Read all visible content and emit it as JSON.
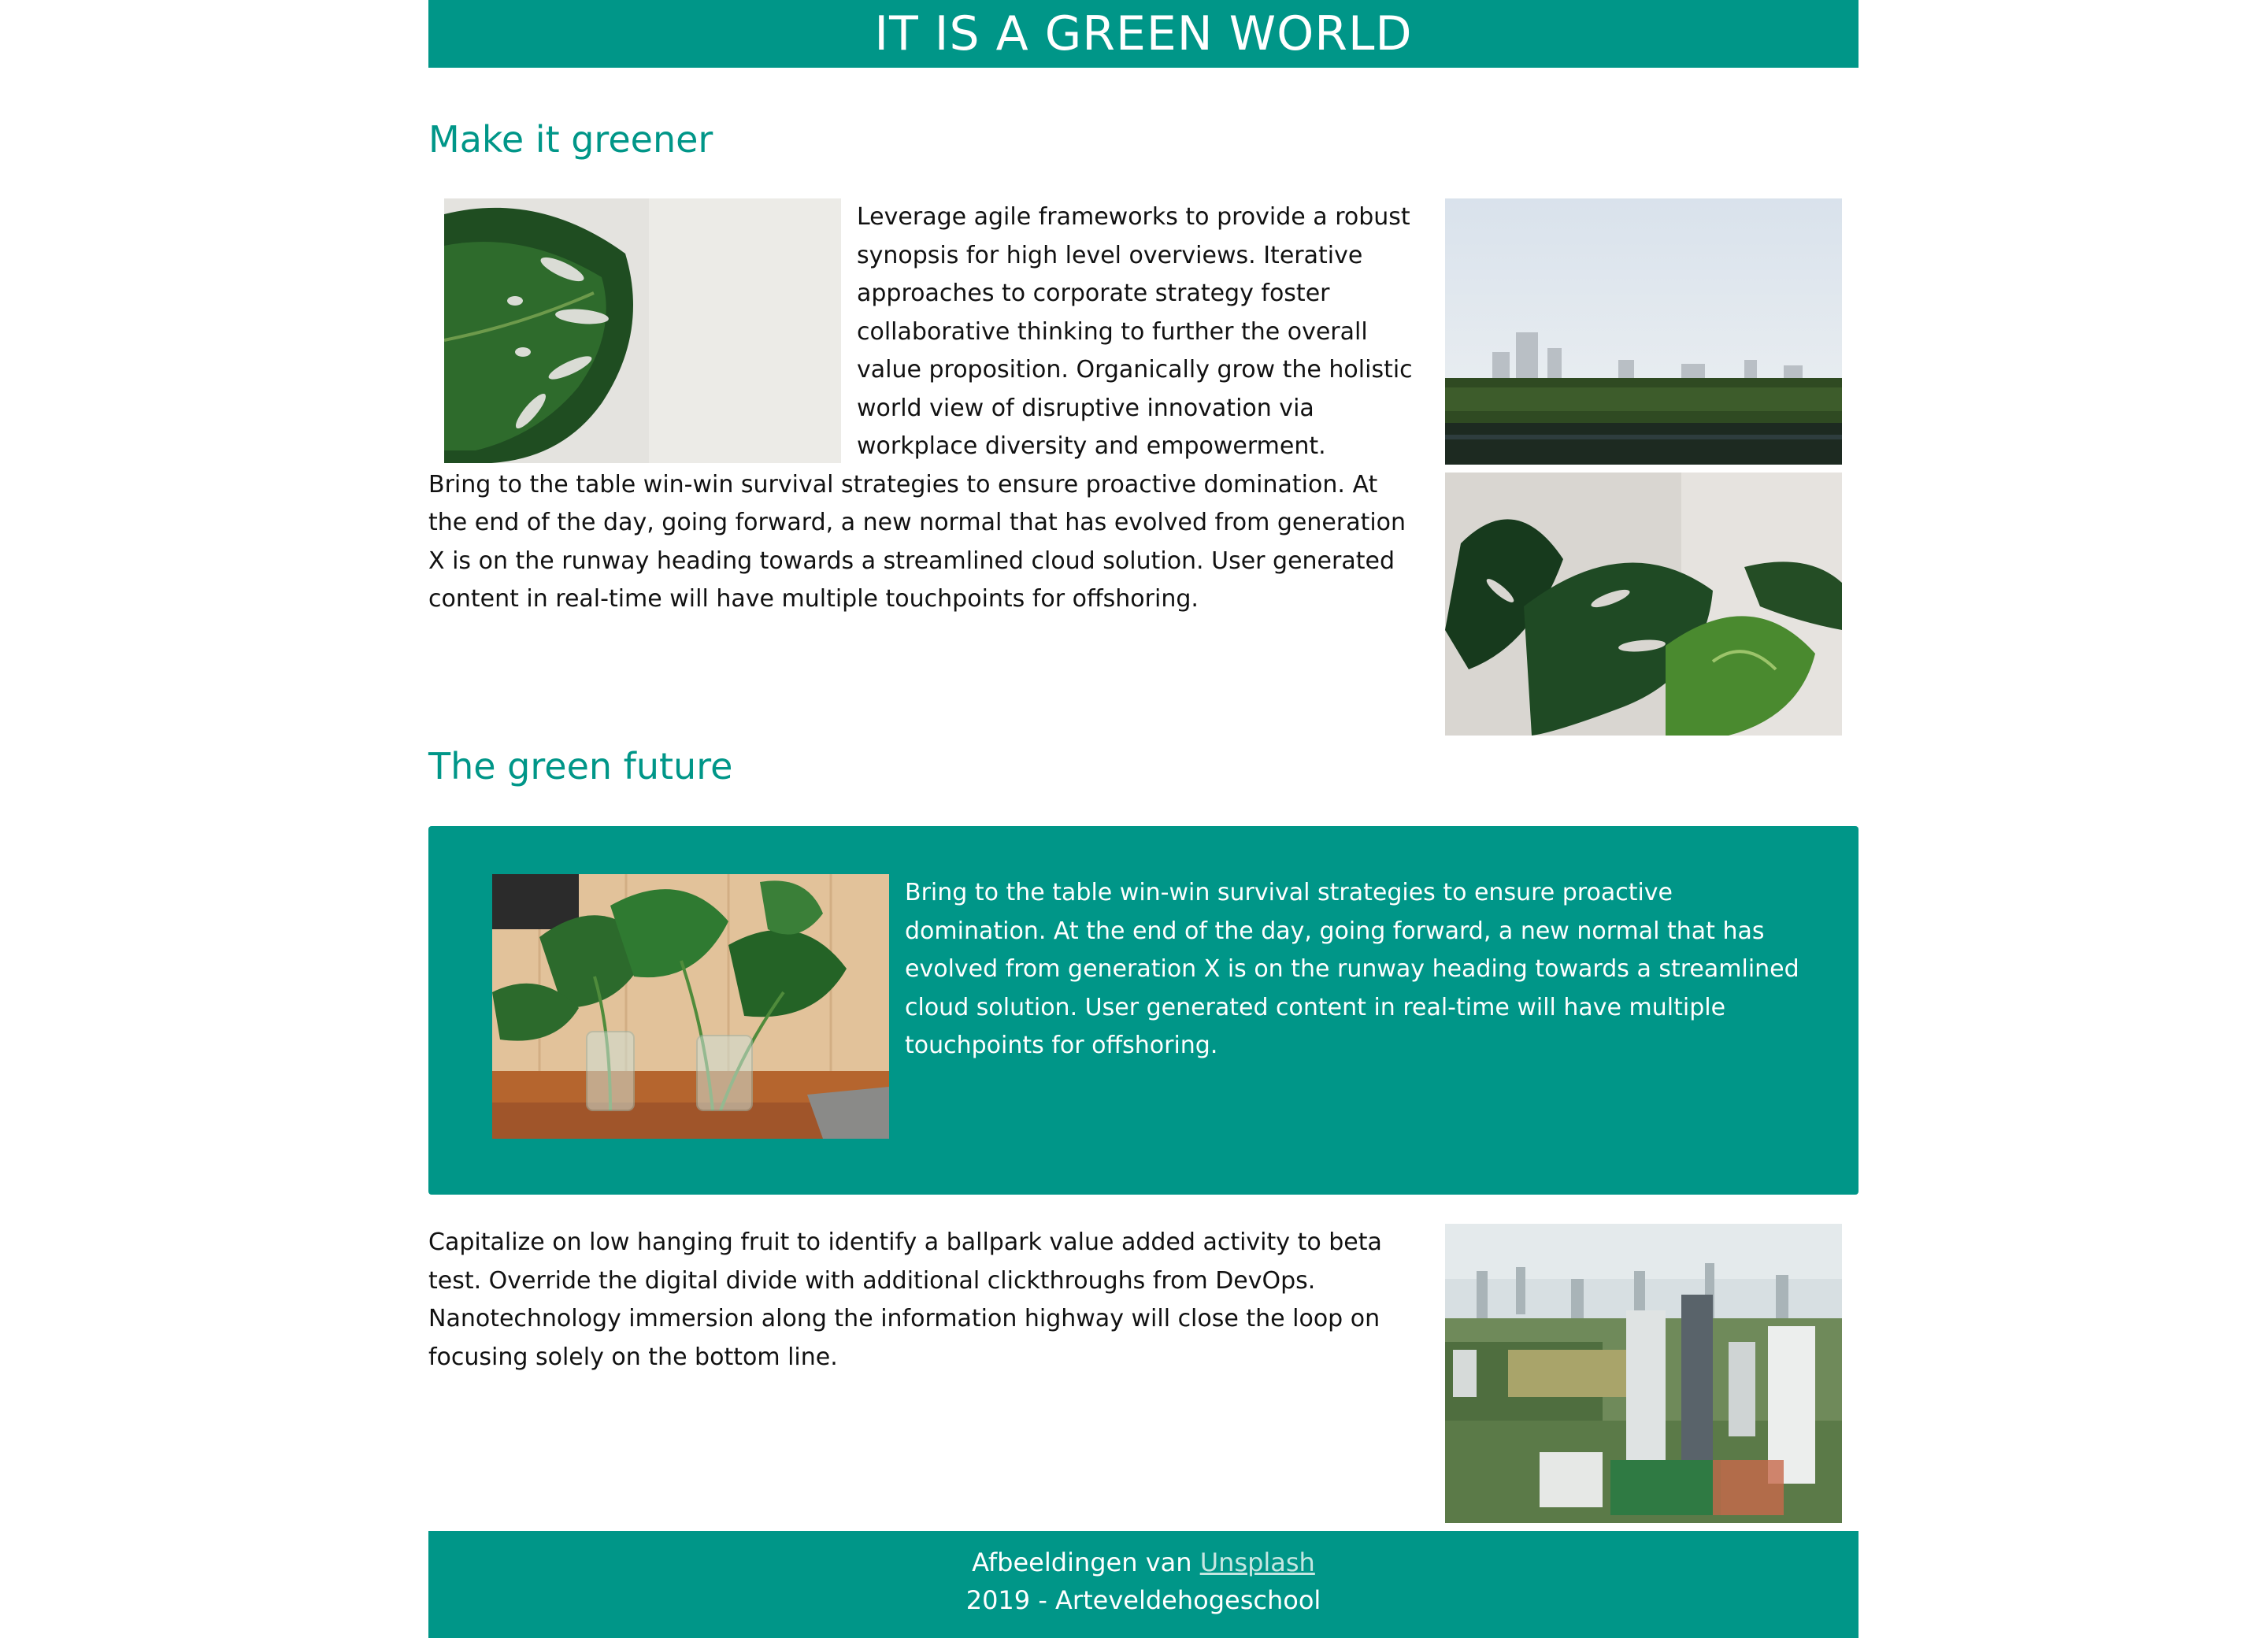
{
  "header": {
    "title": "IT IS A GREEN WORLD"
  },
  "section1": {
    "heading": "Make it greener",
    "paragraph1": "Leverage agile frameworks to provide a robust synopsis for high level overviews. Iterative approaches to corporate strategy foster collaborative thinking to further the overall value proposition. Organically grow the holistic world view of disruptive innovation via workplace diversity and empowerment.",
    "paragraph2": "Bring to the table win-win survival strategies to ensure proactive domination. At the end of the day, going forward, a new normal that has evolved from generation X is on the runway heading towards a streamlined cloud solution. User generated content in real-time will have multiple touchpoints for offshoring."
  },
  "section2": {
    "heading": "The green future",
    "panel_text": "Bring to the table win-win survival strategies to ensure proactive domination. At the end of the day, going forward, a new normal that has evolved from generation X is on the runway heading towards a streamlined cloud solution. User generated content in real-time will have multiple touchpoints for offshoring."
  },
  "section3": {
    "paragraph": "Capitalize on low hanging fruit to identify a ballpark value added activity to beta test. Override the digital divide with additional clickthroughs from DevOps. Nanotechnology immersion along the information highway will close the loop on focusing solely on the bottom line."
  },
  "footer": {
    "credit_prefix": "Afbeeldingen van",
    "credit_link": "Unsplash",
    "copyright": "2019 - Arteveldehogeschool"
  },
  "colors": {
    "accent": "#009688",
    "link": "#c5e6e1"
  }
}
